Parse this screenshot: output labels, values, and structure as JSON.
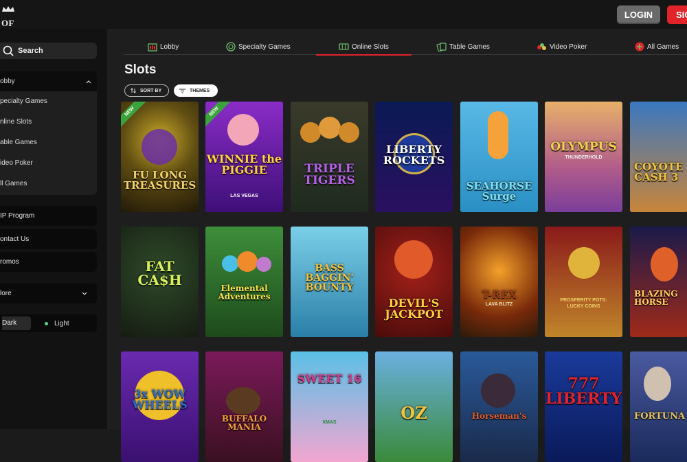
{
  "header": {
    "brand": "OF CHANCE",
    "login_label": "LOGIN",
    "signup_label": "SIG"
  },
  "sidebar": {
    "search_label": "Search",
    "lobby_label": "obby",
    "lobby_items": [
      {
        "label": "pecialty Games"
      },
      {
        "label": "nline Slots"
      },
      {
        "label": "able Games"
      },
      {
        "label": "ideo Poker"
      },
      {
        "label": "ll Games"
      }
    ],
    "vip_label": "IP Program",
    "contact_label": "ontact Us",
    "promos_label": "romos",
    "more_label": "lore",
    "theme_dark": "Dark",
    "theme_light": "Light"
  },
  "tabs": [
    {
      "label": "Lobby",
      "icon": "lobby-icon"
    },
    {
      "label": "Specialty Games",
      "icon": "specialty-icon"
    },
    {
      "label": "Online Slots",
      "icon": "slots-icon"
    },
    {
      "label": "Table Games",
      "icon": "cards-icon"
    },
    {
      "label": "Video Poker",
      "icon": "chips-icon"
    },
    {
      "label": "All Games",
      "icon": "all-games-icon"
    }
  ],
  "page": {
    "title": "Slots",
    "sort_label": "SORT BY",
    "themes_label": "THEMES"
  },
  "games": [
    {
      "title": "FU LONG TREASURES",
      "badge": "NEW"
    },
    {
      "title": "WINNIE the PIGGIE",
      "subtitle": "LAS VEGAS",
      "badge": "NEW"
    },
    {
      "title": "TRIPLE TIGERS"
    },
    {
      "title": "LIBERTY ROCKETS"
    },
    {
      "title": "SEAHORSE Surge"
    },
    {
      "title": "OLYMPUS",
      "subtitle": "THUNDERHOLD"
    },
    {
      "title": "COYOTE CASH 3"
    },
    {
      "title": "FAT CA$H"
    },
    {
      "title": "Elemental Adventures"
    },
    {
      "title": "BASS BAGGIN' BOUNTY"
    },
    {
      "title": "DEVIL'S JACKPOT"
    },
    {
      "title": "T-REX",
      "subtitle": "LAVA BLITZ"
    },
    {
      "title": "PROSPERITY POTS:",
      "subtitle": "LUCKY COINS"
    },
    {
      "title": "BLAZING HORSE"
    },
    {
      "title": "3x WOW WHEELS"
    },
    {
      "title": "BUFFALO MANIA"
    },
    {
      "title": "SWEET 16",
      "subtitle": "XMAS"
    },
    {
      "title": "OZ"
    },
    {
      "title": "Horseman's"
    },
    {
      "title": "777 LIBERTY"
    },
    {
      "title": "FORTUNA"
    }
  ]
}
